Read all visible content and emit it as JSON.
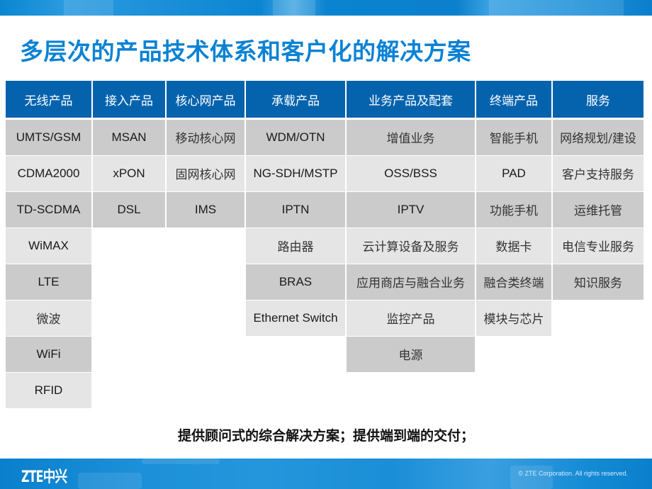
{
  "slide": {
    "title": "多层次的产品技术体系和客户化的解决方案",
    "tagline": "提供顾问式的综合解决方案；提供端到端的交付；"
  },
  "table": {
    "headers": [
      "无线产品",
      "接入产品",
      "核心网产品",
      "承载产品",
      "业务产品及配套",
      "终端产品",
      "服务"
    ],
    "columns": [
      [
        "UMTS/GSM",
        "CDMA2000",
        "TD-SCDMA",
        "WiMAX",
        "LTE",
        "微波",
        "WiFi",
        "RFID"
      ],
      [
        "MSAN",
        "xPON",
        "DSL"
      ],
      [
        "移动核心网",
        "固网核心网",
        "IMS"
      ],
      [
        "WDM/OTN",
        "NG-SDH/MSTP",
        "IPTN",
        "路由器",
        "BRAS",
        "Ethernet Switch"
      ],
      [
        "增值业务",
        "OSS/BSS",
        "IPTV",
        "云计算设备及服务",
        "应用商店与融合业务",
        "监控产品",
        "电源"
      ],
      [
        "智能手机",
        "PAD",
        "功能手机",
        "数据卡",
        "融合类终端",
        "模块与芯片"
      ],
      [
        "网络规划/建设",
        "客户支持服务",
        "运维托管",
        "电信专业服务",
        "知识服务"
      ]
    ]
  },
  "footer": {
    "logo": "ZTE中兴",
    "copyright": "© ZTE Corporation. All rights reserved."
  },
  "colors": {
    "title": "#0a82d4",
    "header_bg": "#0563ad",
    "row_dark": "#cbcbcb",
    "row_light": "#e5e5e5",
    "bar_blue": "#0a84d0"
  }
}
